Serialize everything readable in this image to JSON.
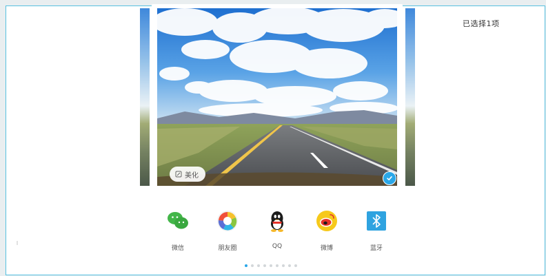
{
  "header": {
    "selected_count_label": "已选择1项"
  },
  "photo": {
    "beautify_label": "美化",
    "selected": true
  },
  "share": {
    "items": [
      {
        "label": "微信",
        "icon": "wechat-icon"
      },
      {
        "label": "朋友圈",
        "icon": "moments-icon"
      },
      {
        "label": "QQ",
        "icon": "qq-icon"
      },
      {
        "label": "微博",
        "icon": "weibo-icon"
      },
      {
        "label": "蓝牙",
        "icon": "bluetooth-icon"
      }
    ]
  },
  "pagination": {
    "total": 9,
    "active_index": 0
  },
  "colors": {
    "accent": "#2aa7e8",
    "frame_border": "#55c0e0"
  }
}
